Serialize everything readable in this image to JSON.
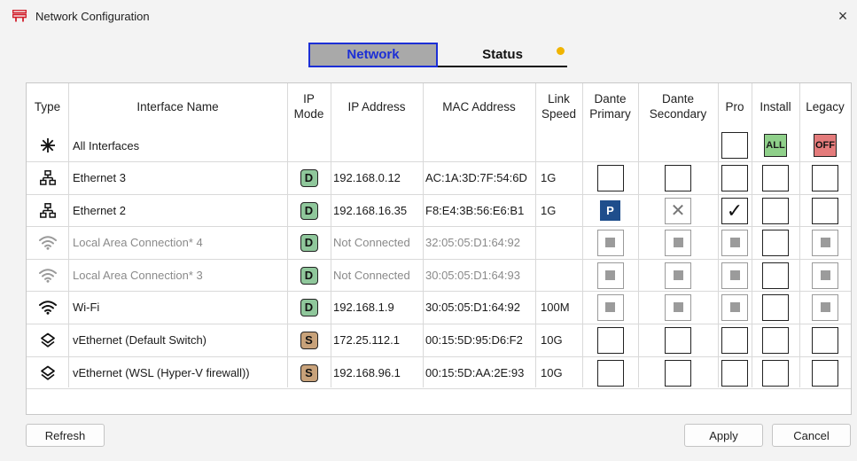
{
  "window": {
    "title": "Network Configuration",
    "close_glyph": "×"
  },
  "tabs": [
    {
      "label": "Network",
      "active": true
    },
    {
      "label": "Status",
      "active": false
    }
  ],
  "status_indicator_color": "#f0b400",
  "columns": {
    "type": "Type",
    "name": "Interface Name",
    "ip_mode": "IP\nMode",
    "ip_address": "IP Address",
    "mac_address": "MAC Address",
    "link_speed": "Link\nSpeed",
    "dante_primary": "Dante\nPrimary",
    "dante_secondary": "Dante\nSecondary",
    "pro": "Pro",
    "install": "Install",
    "legacy": "Legacy"
  },
  "all_interfaces": {
    "icon": "asterisk-icon",
    "name": "All Interfaces",
    "install_label": "ALL",
    "legacy_label": "OFF"
  },
  "rows": [
    {
      "icon": "ethernet-icon",
      "name": "Ethernet 3",
      "dim": false,
      "mode": "D",
      "ip": "192.168.0.12",
      "mac": "AC:1A:3D:7F:54:6D",
      "speed": "1G",
      "primary": "empty",
      "secondary": "empty",
      "pro": "empty",
      "install": "empty",
      "legacy": "empty"
    },
    {
      "icon": "ethernet-icon",
      "name": "Ethernet 2",
      "dim": false,
      "mode": "D",
      "ip": "192.168.16.35",
      "mac": "F8:E4:3B:56:E6:B1",
      "speed": "1G",
      "primary": "P",
      "secondary": "x",
      "pro": "check",
      "install": "empty",
      "legacy": "empty"
    },
    {
      "icon": "wifi-icon-dim",
      "name": "Local Area Connection* 4",
      "dim": true,
      "mode": "D",
      "ip": "Not Connected",
      "mac": "32:05:05:D1:64:92",
      "speed": "",
      "primary": "disabled",
      "secondary": "disabled",
      "pro": "disabled",
      "install": "empty",
      "legacy": "disabled"
    },
    {
      "icon": "wifi-icon-dim",
      "name": "Local Area Connection* 3",
      "dim": true,
      "mode": "D",
      "ip": "Not Connected",
      "mac": "30:05:05:D1:64:93",
      "speed": "",
      "primary": "disabled",
      "secondary": "disabled",
      "pro": "disabled",
      "install": "empty",
      "legacy": "disabled"
    },
    {
      "icon": "wifi-icon",
      "name": "Wi-Fi",
      "dim": false,
      "mode": "D",
      "ip": "192.168.1.9",
      "mac": "30:05:05:D1:64:92",
      "speed": "100M",
      "primary": "disabled",
      "secondary": "disabled",
      "pro": "disabled",
      "install": "empty",
      "legacy": "disabled"
    },
    {
      "icon": "vswitch-icon",
      "name": "vEthernet (Default Switch)",
      "dim": false,
      "mode": "S",
      "ip": "172.25.112.1",
      "mac": "00:15:5D:95:D6:F2",
      "speed": "10G",
      "primary": "empty",
      "secondary": "empty",
      "pro": "empty",
      "install": "empty",
      "legacy": "empty"
    },
    {
      "icon": "vswitch-icon",
      "name": "vEthernet (WSL (Hyper-V firewall))",
      "dim": false,
      "mode": "S",
      "ip": "192.168.96.1",
      "mac": "00:15:5D:AA:2E:93",
      "speed": "10G",
      "primary": "empty",
      "secondary": "empty",
      "pro": "empty",
      "install": "empty",
      "legacy": "empty"
    }
  ],
  "footer": {
    "refresh": "Refresh",
    "apply": "Apply",
    "cancel": "Cancel"
  },
  "colors": {
    "active_tab_border": "#1c2fd6",
    "dhcp_badge": "#8fc79b",
    "static_badge": "#c8a27a",
    "primary_badge": "#1f4e8c",
    "all_button": "#8fd08a",
    "off_button": "#e47b7b"
  }
}
